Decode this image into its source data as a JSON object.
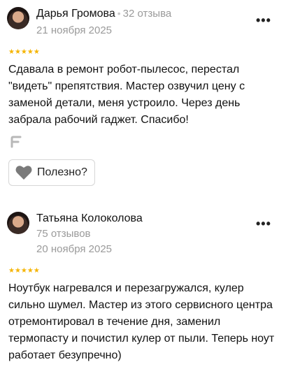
{
  "reviews": [
    {
      "author": "Дарья Громова",
      "reviews_count": "32 отзыва",
      "date": "21 ноября 2025",
      "rating": "★★★★★",
      "text": "Сдавала в ремонт робот-пылесос, перестал \"видеть\" препятствия. Мастер озвучил цену с заменой детали, меня устроило. Через день забрала рабочий гаджет. Спасибо!",
      "more": "•••",
      "useful_label": "Полезно?"
    },
    {
      "author": "Татьяна Колоколова",
      "reviews_count": "75 отзывов",
      "date": "20 ноября 2025",
      "rating": "★★★★★",
      "text": "Ноутбук нагревался и перезагружался, кулер сильно шумел. Мастер из этого сервисного центра отремонтировал в течение дня, заменил термопасту и почистил кулер от пыли. Теперь ноут работает безупречно)",
      "more": "•••"
    }
  ],
  "icons": {
    "heart": "heart-icon",
    "badge": "f-badge-icon",
    "more": "more-icon",
    "star_color": "#f5b400"
  }
}
